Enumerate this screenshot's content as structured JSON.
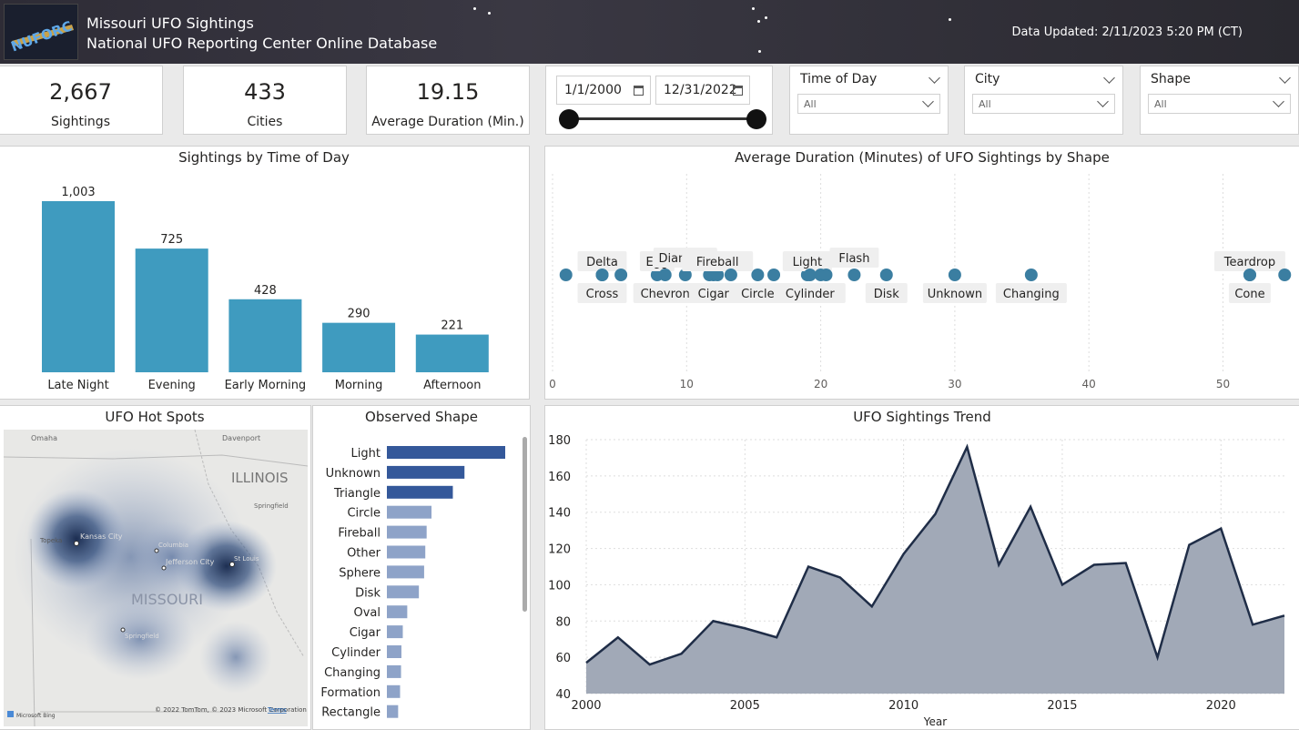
{
  "header": {
    "title": "Missouri UFO Sightings",
    "subtitle": "National UFO Reporting Center Online Database",
    "updated": "Data Updated: 2/11/2023 5:20 PM (CT)",
    "logo_text": "NUFORC"
  },
  "kpis": [
    {
      "value": "2,667",
      "label": "Sightings"
    },
    {
      "value": "433",
      "label": "Cities"
    },
    {
      "value": "19.15",
      "label": "Average Duration (Min.)"
    }
  ],
  "date_filter": {
    "start": "1/1/2000",
    "end": "12/31/2022"
  },
  "slicers": [
    {
      "title": "Time of Day",
      "value": "All"
    },
    {
      "title": "City",
      "value": "All"
    },
    {
      "title": "Shape",
      "value": "All"
    }
  ],
  "colors": {
    "bar": "#3f9bbf",
    "dot": "#3b7ea1",
    "shape_dark": "#34589a",
    "shape_light": "#8ea3c8",
    "area_fill": "#a1a9b7",
    "area_line": "#1f2d47"
  },
  "map": {
    "title": "UFO Hot Spots",
    "labels": {
      "omaha": "Omaha",
      "davenport": "Davenport",
      "illinois": "ILLINOIS",
      "springfield_il": "Springfield",
      "topeka": "Topeka",
      "kansas_city": "Kansas City",
      "columbia": "Columbia",
      "jefferson_city": "Jefferson City",
      "st_louis": "St Louis",
      "missouri": "MISSOURI",
      "springfield_mo": "Springfield"
    },
    "copyright": "© 2022 TomTom, © 2023 Microsoft Corporation",
    "terms": "Terms",
    "bing": "Microsoft Bing"
  },
  "chart_data": [
    {
      "type": "bar",
      "title": "Sightings by Time of Day",
      "categories": [
        "Late Night",
        "Evening",
        "Early Morning",
        "Morning",
        "Afternoon"
      ],
      "values": [
        1003,
        725,
        428,
        290,
        221
      ],
      "value_labels": [
        "1,003",
        "725",
        "428",
        "290",
        "221"
      ]
    },
    {
      "type": "scatter",
      "title": "Average Duration (Minutes) of UFO Sightings by Shape",
      "x_ticks": [
        "0",
        "10",
        "20",
        "30",
        "40",
        "50"
      ],
      "xlim": [
        0,
        55
      ],
      "points": [
        {
          "name": "",
          "x": 1.0
        },
        {
          "name": "Delta",
          "x": 3.7
        },
        {
          "name": "Cross",
          "x": 3.7
        },
        {
          "name": "",
          "x": 5.1
        },
        {
          "name": "Egg",
          "x": 7.8
        },
        {
          "name": "Chevron",
          "x": 8.4
        },
        {
          "name": "Diamond",
          "x": 9.9
        },
        {
          "name": "",
          "x": 11.7
        },
        {
          "name": "Cigar",
          "x": 12.0
        },
        {
          "name": "Fireball",
          "x": 12.3
        },
        {
          "name": "",
          "x": 13.3
        },
        {
          "name": "Circle",
          "x": 15.3
        },
        {
          "name": "",
          "x": 16.5
        },
        {
          "name": "Light",
          "x": 19.0
        },
        {
          "name": "Cylinder",
          "x": 19.2
        },
        {
          "name": "",
          "x": 20.0
        },
        {
          "name": "",
          "x": 20.4
        },
        {
          "name": "Flash",
          "x": 22.5
        },
        {
          "name": "Disk",
          "x": 24.9
        },
        {
          "name": "Unknown",
          "x": 30.0
        },
        {
          "name": "Changing",
          "x": 35.7
        },
        {
          "name": "Teardrop",
          "x": 52.0
        },
        {
          "name": "Cone",
          "x": 52.0
        },
        {
          "name": "",
          "x": 54.6
        }
      ]
    },
    {
      "type": "bar",
      "title": "Observed Shape",
      "orientation": "horizontal",
      "categories": [
        "Light",
        "Unknown",
        "Triangle",
        "Circle",
        "Fireball",
        "Other",
        "Sphere",
        "Disk",
        "Oval",
        "Cigar",
        "Cylinder",
        "Changing",
        "Formation",
        "Rectangle"
      ],
      "values": [
        610,
        400,
        340,
        230,
        205,
        198,
        192,
        165,
        105,
        82,
        75,
        73,
        68,
        58
      ]
    },
    {
      "type": "area",
      "title": "UFO Sightings Trend",
      "xlabel": "Year",
      "x": [
        2000,
        2001,
        2002,
        2003,
        2004,
        2005,
        2006,
        2007,
        2008,
        2009,
        2010,
        2011,
        2012,
        2013,
        2014,
        2015,
        2016,
        2017,
        2018,
        2019,
        2020,
        2021,
        2022
      ],
      "values": [
        57,
        71,
        56,
        62,
        80,
        76,
        71,
        110,
        104,
        88,
        117,
        139,
        176,
        111,
        143,
        100,
        111,
        112,
        60,
        122,
        131,
        78,
        83
      ],
      "ylim": [
        40,
        180
      ],
      "y_ticks": [
        "40",
        "60",
        "80",
        "100",
        "120",
        "140",
        "160",
        "180"
      ],
      "x_ticks": [
        "2000",
        "2005",
        "2010",
        "2015",
        "2020"
      ]
    }
  ]
}
